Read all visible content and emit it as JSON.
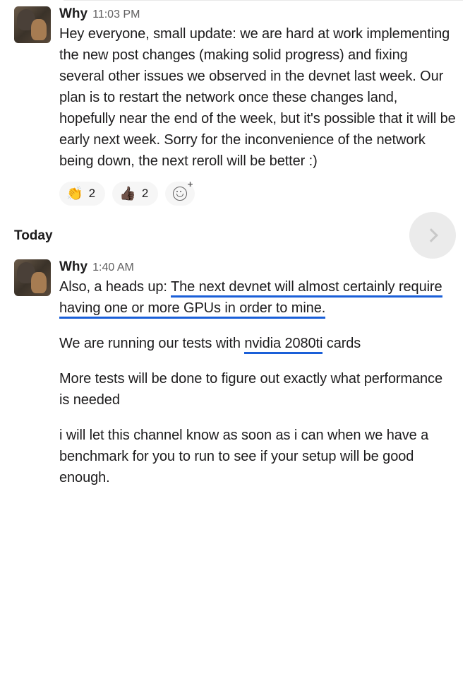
{
  "messages": [
    {
      "author": "Why",
      "timestamp": "11:03 PM",
      "body": "Hey everyone, small update: we are hard at work implementing the new post changes (making solid progress) and fixing several other issues we observed in the devnet last week. Our plan is to restart the network once these changes land, hopefully near the end of the week, but it's possible that it will be early next week. Sorry for the inconvenience of the network being down, the next reroll will be better :)",
      "reactions": [
        {
          "emoji": "👏",
          "count": "2"
        },
        {
          "emoji": "👍🏿",
          "count": "2"
        }
      ]
    },
    {
      "author": "Why",
      "timestamp": "1:40 AM",
      "paragraphs": {
        "p1_prefix": "Also, a heads up: ",
        "p1_underlined": "The next devnet will almost certainly require having one or more GPUs in order to mine.",
        "p2_prefix": "We are running our tests with ",
        "p2_underlined": "nvidia 2080ti",
        "p2_suffix": " cards",
        "p3": "More tests will be done to figure out exactly what performance is needed",
        "p4": "i will let this channel know as soon as i can when we have a benchmark for you to run to see if your setup will be good enough."
      }
    }
  ],
  "divider": {
    "label": "Today"
  }
}
